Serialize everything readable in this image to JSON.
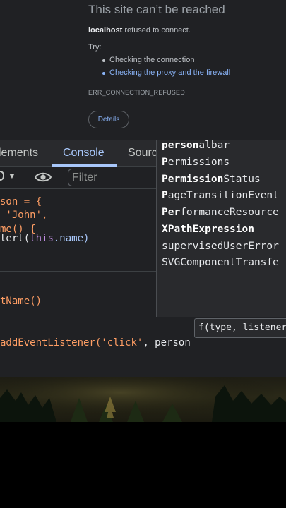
{
  "error_page": {
    "title": "This site can’t be reached",
    "host": "localhost",
    "message": " refused to connect.",
    "try_label": "Try:",
    "suggestions": [
      "Checking the connection",
      "Checking the proxy and the firewall"
    ],
    "error_code": "ERR_CONNECTION_REFUSED",
    "details_button": "Details"
  },
  "devtools": {
    "tabs": [
      "lements",
      "Console",
      "Sourc"
    ],
    "active_tab": "Console",
    "filter_placeholder": "Filter",
    "code_lines": [
      {
        "a": "son = {",
        "kind": "obj"
      },
      {
        "a": " 'John',",
        "kind": "str"
      },
      {
        "a": "me() {",
        "kind": "fn"
      },
      {
        "a": "lert(",
        "b": "this",
        "c": ".name)",
        "kind": "alert"
      }
    ],
    "history_line": "tName()",
    "input_line": {
      "pre": "addEventListener(",
      "str": "'click'",
      "post": ", person"
    }
  },
  "autocomplete": {
    "items": [
      {
        "bold": "person",
        "rest": "albar"
      },
      {
        "bold": "P",
        "mid": "ermission",
        "rest": "s"
      },
      {
        "bold": "Permission",
        "rest": "Status"
      },
      {
        "bold": "P",
        "mid": "ageTransition",
        "rest": "Event"
      },
      {
        "bold": "Per",
        "rest": "formanceResource"
      },
      {
        "bold": "XPathExpression",
        "rest": ""
      },
      {
        "bold": "",
        "rest": "supervisedUserError"
      },
      {
        "bold": "",
        "rest": "SVGComponentTransfe"
      }
    ],
    "signature": "f(type, listener, ?"
  },
  "colors": {
    "accent": "#a8c7fa",
    "link": "#8ab4f8",
    "string": "#ff9e64",
    "keyword": "#c792ea",
    "panel_bg": "#202124"
  }
}
